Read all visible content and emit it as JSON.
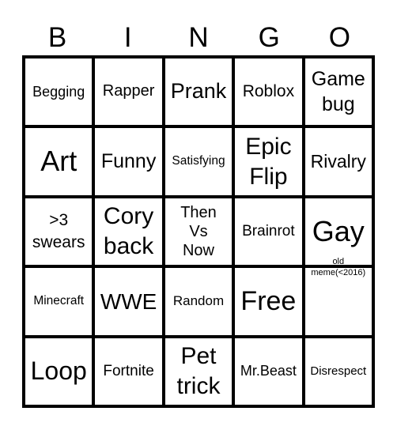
{
  "header": [
    "B",
    "I",
    "N",
    "G",
    "O"
  ],
  "board": {
    "rows": [
      [
        {
          "text": "Begging",
          "size": "s"
        },
        {
          "text": "Rapper",
          "size": "m"
        },
        {
          "text": "Prank",
          "size": "l"
        },
        {
          "text": "Roblox",
          "size": "m"
        },
        {
          "text": "Game\nbug",
          "size": "l"
        }
      ],
      [
        {
          "text": "Art",
          "size": "xl"
        },
        {
          "text": "Funny",
          "size": "l"
        },
        {
          "text": "Satisfying",
          "size": "xs"
        },
        {
          "text": "Epic\nFlip",
          "size": "l"
        },
        {
          "text": "Rivalry",
          "size": "m"
        }
      ],
      [
        {
          "text": ">3\nswears",
          "size": "m"
        },
        {
          "text": "Cory\nback",
          "size": "l"
        },
        {
          "text": "Then\nVs\nNow",
          "size": "m"
        },
        {
          "text": "Brainrot",
          "size": "s"
        },
        {
          "text": "Gay",
          "size": "xl"
        }
      ],
      [
        {
          "text": "Minecraft",
          "size": "xs"
        },
        {
          "text": "WWE",
          "size": "l"
        },
        {
          "text": "Random",
          "size": "s"
        },
        {
          "text": "Free",
          "size": "xl"
        },
        {
          "text": "old\nmeme(<2016)",
          "size": "xxs"
        }
      ],
      [
        {
          "text": "Loop",
          "size": "xl"
        },
        {
          "text": "Fortnite",
          "size": "s"
        },
        {
          "text": "Pet\ntrick",
          "size": "l"
        },
        {
          "text": "Mr.Beast",
          "size": "s"
        },
        {
          "text": "Disrespect",
          "size": "xs"
        }
      ]
    ]
  }
}
